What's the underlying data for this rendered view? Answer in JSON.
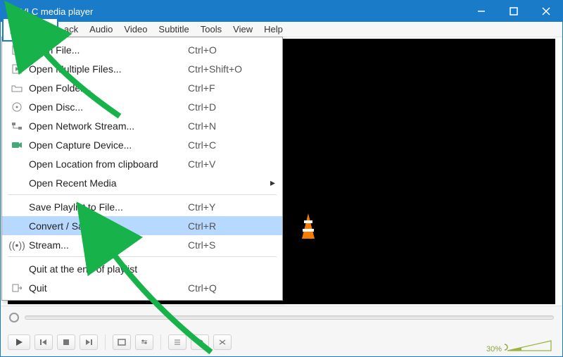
{
  "titlebar": {
    "title": "VLC media player"
  },
  "menubar": {
    "media": "Media",
    "items": [
      "ack",
      "Audio",
      "Video",
      "Subtitle",
      "Tools",
      "View",
      "Help"
    ]
  },
  "dropdown": {
    "items": [
      {
        "icon": "play-file",
        "label": "Open File...",
        "shortcut": "Ctrl+O"
      },
      {
        "icon": "play-file",
        "label": "Open Multiple Files...",
        "shortcut": "Ctrl+Shift+O"
      },
      {
        "icon": "folder",
        "label": "Open Folder...",
        "shortcut": "Ctrl+F"
      },
      {
        "icon": "disc",
        "label": "Open Disc...",
        "shortcut": "Ctrl+D"
      },
      {
        "icon": "network",
        "label": "Open Network Stream...",
        "shortcut": "Ctrl+N"
      },
      {
        "icon": "capture",
        "label": "Open Capture Device...",
        "shortcut": "Ctrl+C"
      },
      {
        "icon": "",
        "label": "Open Location from clipboard",
        "shortcut": "Ctrl+V"
      },
      {
        "icon": "",
        "label": "Open Recent Media",
        "shortcut": "",
        "submenu": true
      }
    ],
    "group2": [
      {
        "icon": "",
        "label": "Save Playlist to File...",
        "shortcut": "Ctrl+Y"
      },
      {
        "icon": "",
        "label": "Convert / Save...",
        "shortcut": "Ctrl+R",
        "highlight": true
      },
      {
        "icon": "stream",
        "label": "Stream...",
        "shortcut": "Ctrl+S"
      }
    ],
    "group3": [
      {
        "icon": "",
        "label": "Quit at the end of playlist",
        "shortcut": ""
      },
      {
        "icon": "quit",
        "label": "Quit",
        "shortcut": "Ctrl+Q"
      }
    ]
  },
  "volume": {
    "percent": "30%"
  }
}
